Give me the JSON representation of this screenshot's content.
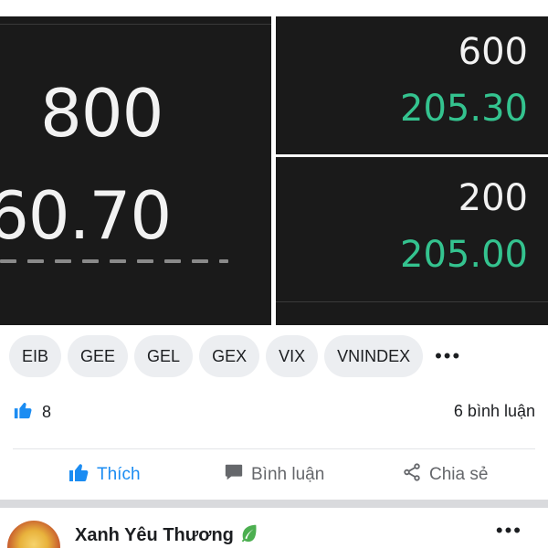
{
  "order_book": {
    "left": {
      "volume": "800",
      "price_partial": "60.70"
    },
    "right": [
      {
        "volume": "600",
        "price": "205.30"
      },
      {
        "volume": "200",
        "price": "205.00"
      }
    ]
  },
  "tags": [
    "EIB",
    "GEE",
    "GEL",
    "GEX",
    "VIX",
    "VNINDEX"
  ],
  "tags_more": "•••",
  "reactions": {
    "likes": "8",
    "comments": "6 bình luận"
  },
  "actions": {
    "like": "Thích",
    "comment": "Bình luận",
    "share": "Chia sẻ"
  },
  "next_post": {
    "author": "Xanh Yêu Thương",
    "more": "•••"
  },
  "colors": {
    "accent": "#1b8cf2",
    "price_green": "#34c38f",
    "panel_bg": "#1a1a1a"
  },
  "icons": [
    "thumbs-up-icon",
    "comment-icon",
    "share-icon",
    "leaf-icon",
    "more-icon"
  ]
}
